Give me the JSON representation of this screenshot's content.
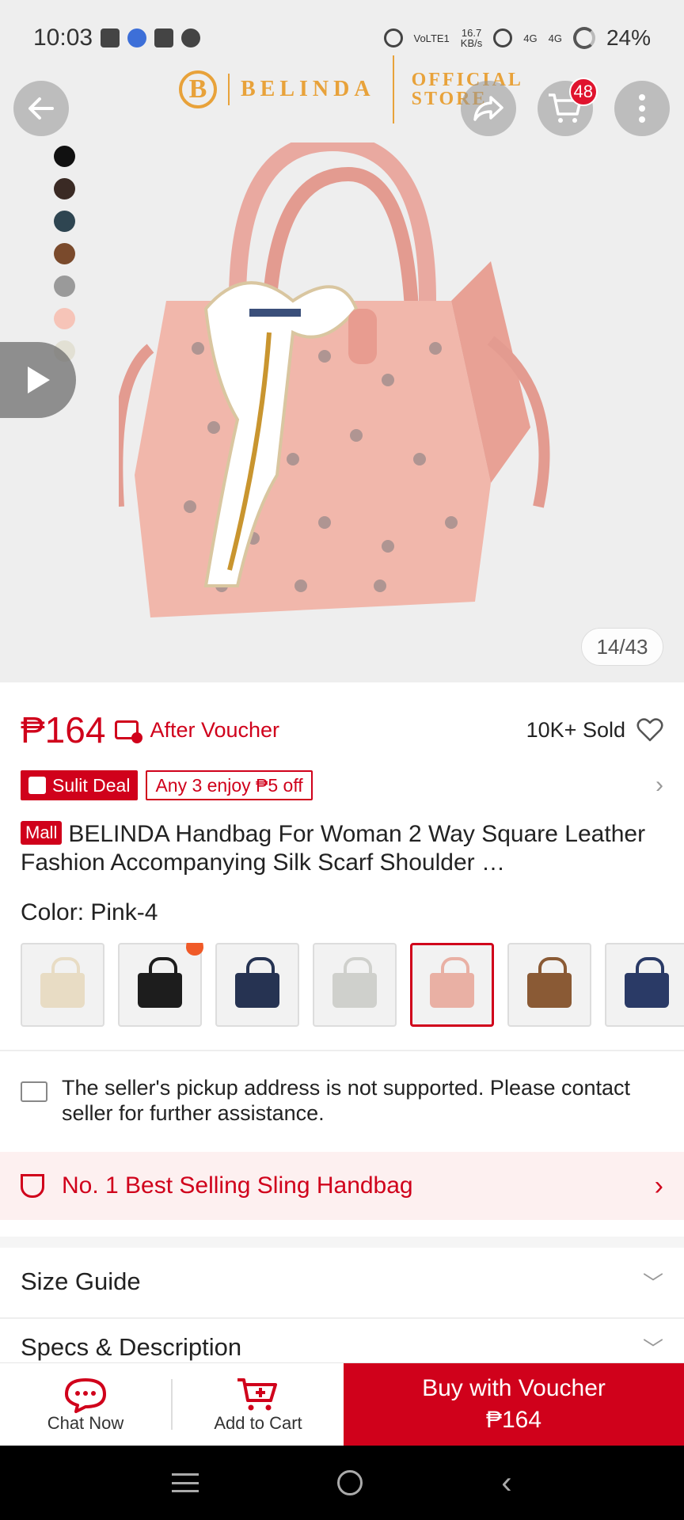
{
  "status_bar": {
    "time": "10:03",
    "network_speed_value": "16.7",
    "network_speed_unit": "KB/s",
    "volte": "VoLTE1",
    "signal1": "4G",
    "signal2": "4G",
    "battery": "24%"
  },
  "brand": {
    "logo_letter": "B",
    "name": "BELINDA",
    "store_line1": "OFFICIAL",
    "store_line2": "STORE"
  },
  "header": {
    "cart_count": "48"
  },
  "gallery": {
    "counter": "14/43",
    "swatch_colors": [
      "#111111",
      "#3a2a24",
      "#2e4551",
      "#7a4a2c",
      "#9a9a9a",
      "#f6c4b8",
      "#e2e0d4"
    ]
  },
  "product": {
    "price": "₱164",
    "after_voucher": "After Voucher",
    "sold": "10K+ Sold",
    "sulit_deal": "Sulit Deal",
    "deal_text": "Any 3 enjoy ₱5 off",
    "mall_badge": "Mall",
    "title": "BELINDA Handbag For Woman 2 Way Square Leather Fashion Accompanying Silk Scarf Shoulder …",
    "color_label": "Color: Pink-4",
    "variant_colors": [
      "#e8dcc4",
      "#1d1d1d",
      "#263352",
      "#cfd0cc",
      "#e9b0a4",
      "#8a5a35",
      "#2a3a66"
    ],
    "selected_variant": 4
  },
  "notice": {
    "text": "The seller's pickup address is not supported. Please contact seller for further assistance."
  },
  "bestseller": {
    "text": "No. 1 Best Selling Sling Handbag"
  },
  "sections": {
    "size_guide": "Size Guide",
    "specs": "Specs & Description"
  },
  "actions": {
    "chat": "Chat Now",
    "add_to_cart": "Add to Cart",
    "buy_line1": "Buy with Voucher",
    "buy_line2": "₱164"
  },
  "colors": {
    "accent": "#d0011b",
    "brand_gold": "#e8a23a"
  }
}
